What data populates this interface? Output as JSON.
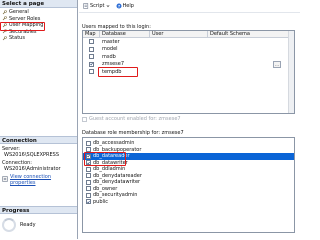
{
  "sidebar": {
    "select_page_label": "Select a page",
    "pages": [
      {
        "label": "General",
        "icon": "wrench-icon"
      },
      {
        "label": "Server Roles",
        "icon": "wrench-icon"
      },
      {
        "label": "User Mapping",
        "icon": "wrench-icon",
        "selected": true
      },
      {
        "label": "Securables",
        "icon": "wrench-icon"
      },
      {
        "label": "Status",
        "icon": "wrench-icon"
      }
    ],
    "connection_label": "Connection",
    "server_label": "Server:",
    "server_value": "WS2016\\SQLEXPRESS",
    "connection_field_label": "Connection:",
    "connection_value": "WS2016\\Administrator",
    "view_props_link": "View connection properties",
    "progress_label": "Progress",
    "progress_status": "Ready",
    "highlight_color": "#e01b1b"
  },
  "toolbar": {
    "script_label": "Script",
    "help_label": "Help"
  },
  "users_mapped": {
    "label": "Users mapped to this login:",
    "columns": [
      "Map",
      "Database",
      "User",
      "Default Schema"
    ],
    "rows": [
      {
        "database": "master",
        "checked": false
      },
      {
        "database": "model",
        "checked": false
      },
      {
        "database": "msdb",
        "checked": false
      },
      {
        "database": "zmsese7",
        "checked": true,
        "highlighted": true
      },
      {
        "database": "tempdb",
        "checked": false
      }
    ]
  },
  "guest_label": "Guest account enabled for: zmsese7",
  "role_membership": {
    "label": "Database role membership for: zmsese7",
    "roles": [
      {
        "name": "db_accessadmin",
        "checked": false
      },
      {
        "name": "db_backupoperator",
        "checked": false
      },
      {
        "name": "db_datareader",
        "checked": true,
        "selected": true,
        "highlighted": true
      },
      {
        "name": "db_datawriter",
        "checked": true,
        "highlighted": true
      },
      {
        "name": "db_ddladmin",
        "checked": false
      },
      {
        "name": "db_denydatareader",
        "checked": false
      },
      {
        "name": "db_denydatawriter",
        "checked": false
      },
      {
        "name": "db_owner",
        "checked": false
      },
      {
        "name": "db_securityadmin",
        "checked": false
      },
      {
        "name": "public",
        "checked": true
      }
    ]
  }
}
